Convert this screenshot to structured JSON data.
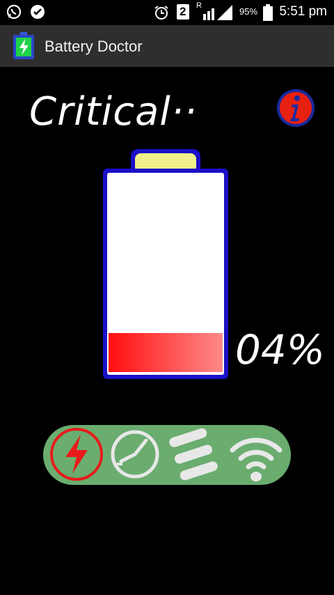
{
  "status_bar": {
    "sim_number": "2",
    "roaming": "R",
    "battery_percent": "95%",
    "time": "5:51 pm",
    "icons": [
      "whatsapp-icon",
      "check-icon",
      "alarm-icon",
      "sim-icon",
      "signal-icon",
      "battery-icon"
    ]
  },
  "app": {
    "title": "Battery Doctor",
    "icon": "battery-charging-icon"
  },
  "main": {
    "status": "Critical··",
    "percent_label": "04%",
    "charge_level": 0.04,
    "info_icon": "info-icon"
  },
  "toolbar": {
    "items": [
      {
        "name": "power-saving",
        "icon": "lightning-icon",
        "active": true
      },
      {
        "name": "schedule",
        "icon": "clock-icon",
        "active": false
      },
      {
        "name": "menu",
        "icon": "menu-icon",
        "active": false
      },
      {
        "name": "wifi",
        "icon": "wifi-icon",
        "active": false
      }
    ]
  },
  "colors": {
    "battery_outline": "#1a10c8",
    "battery_cap": "#f0f08a",
    "battery_fill": "#ff1a1a",
    "toolbar_bg": "#6aad6f",
    "active_icon": "#e81a1a",
    "inactive_icon": "#e8e8e8",
    "info_bg": "#e82010"
  }
}
